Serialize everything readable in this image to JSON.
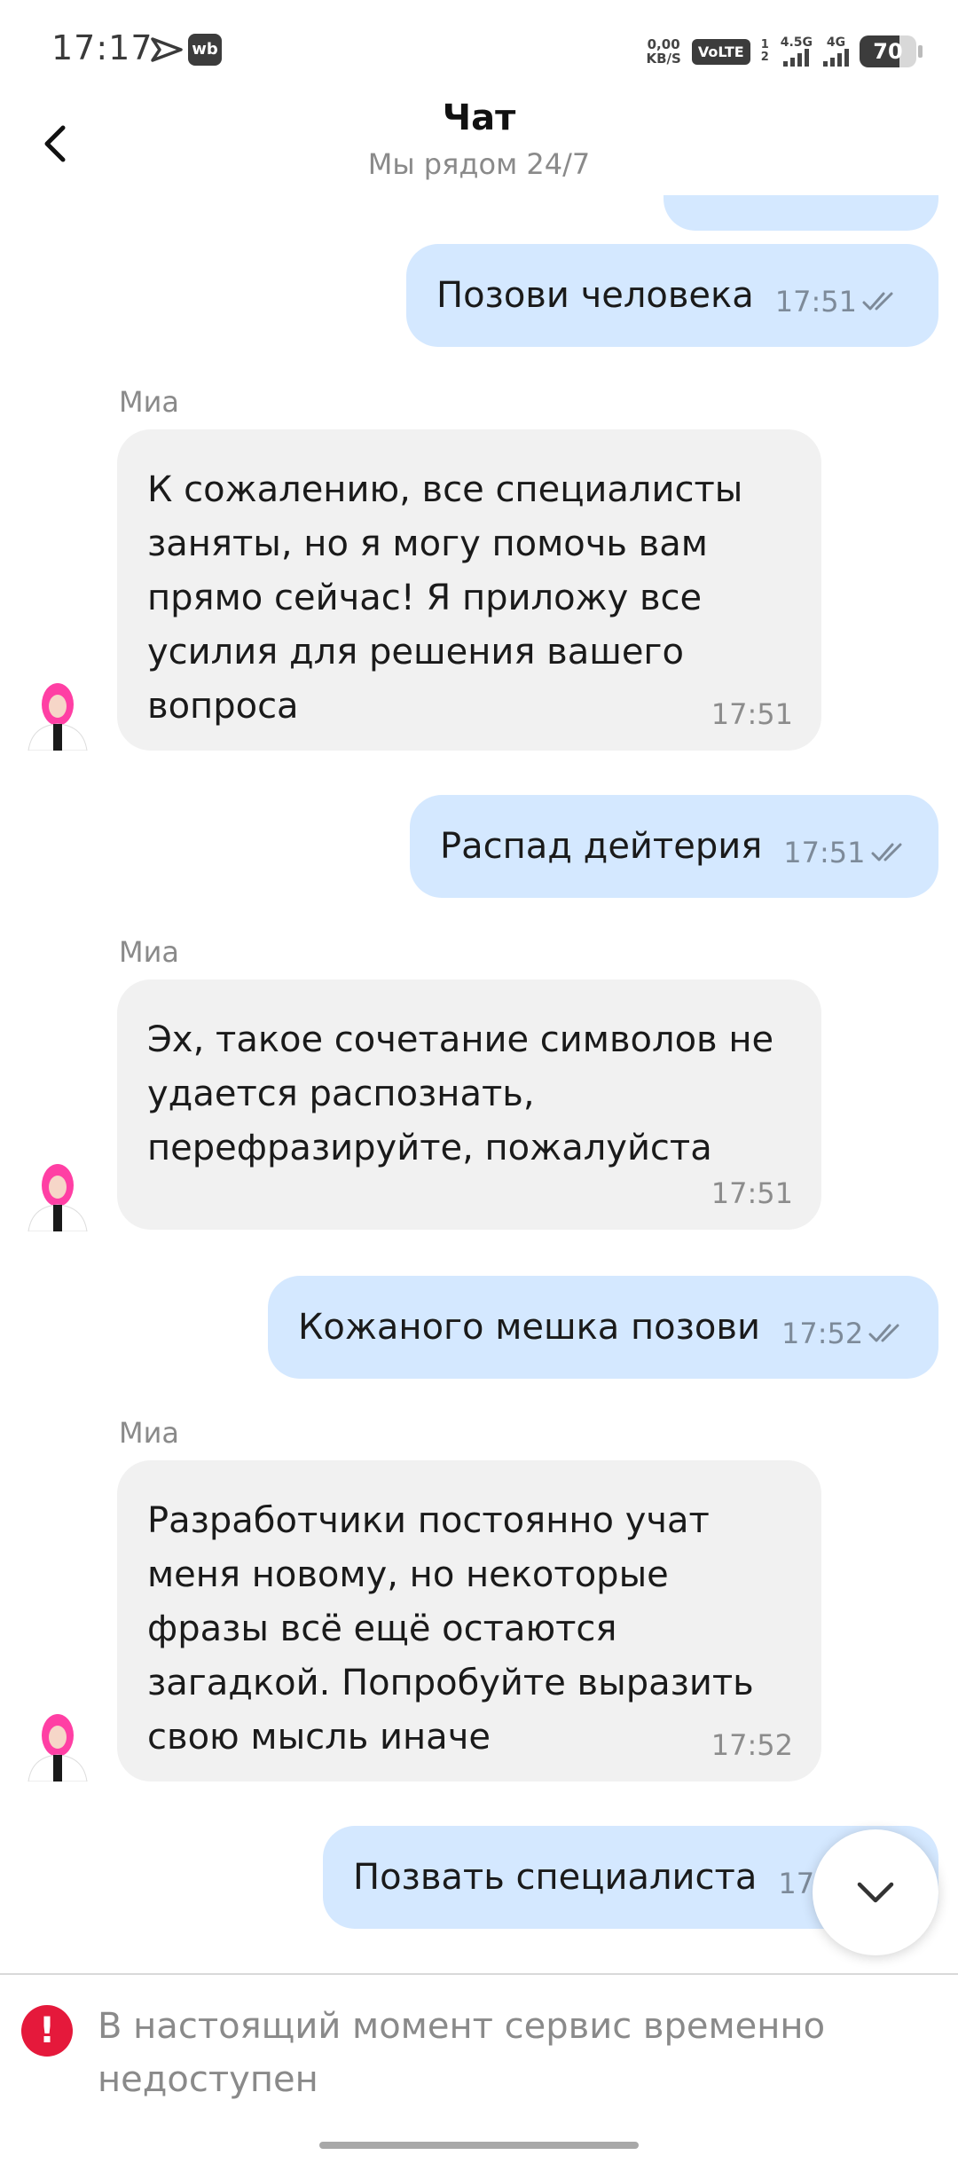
{
  "status_bar": {
    "time": "17:17",
    "app_badge": "wb",
    "net_speed_value": "0,00",
    "net_speed_unit": "KB/S",
    "volte": "VoLTE",
    "sim_slots": "1 2",
    "network1": "4.5G",
    "network2": "4G",
    "battery": "70",
    "battery_level": 0.7
  },
  "header": {
    "title": "Чат",
    "subtitle": "Мы рядом 24/7",
    "back_icon": "chevron-left-icon"
  },
  "messages": [
    {
      "type": "outgoing",
      "text": "Позови человека",
      "time": "17:51",
      "status_icon": "double-check-icon"
    },
    {
      "type": "incoming",
      "sender": "Миа",
      "text": "К сожалению, все специалисты заняты, но я могу помочь вам прямо сейчас! Я приложу все усилия для решения вашего вопроса",
      "time": "17:51"
    },
    {
      "type": "outgoing",
      "text": "Распад дейтерия",
      "time": "17:51",
      "status_icon": "double-check-icon"
    },
    {
      "type": "incoming",
      "sender": "Миа",
      "text": "Эх, такое сочетание символов не удается распознать, перефразируйте, пожалуйста",
      "time": "17:51"
    },
    {
      "type": "outgoing",
      "text": "Кожаного мешка позови",
      "time": "17:52",
      "status_icon": "double-check-icon"
    },
    {
      "type": "incoming",
      "sender": "Миа",
      "text": "Разработчики постоянно учат меня новому, но некоторые фразы всё ещё остаются загадкой. Попробуйте выразить свою мысль иначе",
      "time": "17:52"
    },
    {
      "type": "outgoing",
      "text": "Позвать специалиста",
      "time": "17:52",
      "status_icon": "double-check-icon",
      "partially_hidden": true
    }
  ],
  "scroll_down_icon": "chevron-down-icon",
  "footer": {
    "notice": "В настоящий момент сервис временно недоступен",
    "notice_icon": "exclamation-icon"
  },
  "colors": {
    "outgoing_bubble": "#d4e8ff",
    "incoming_bubble": "#f1f1f1",
    "error": "#e5193b",
    "muted_text": "#8a8a8a"
  }
}
